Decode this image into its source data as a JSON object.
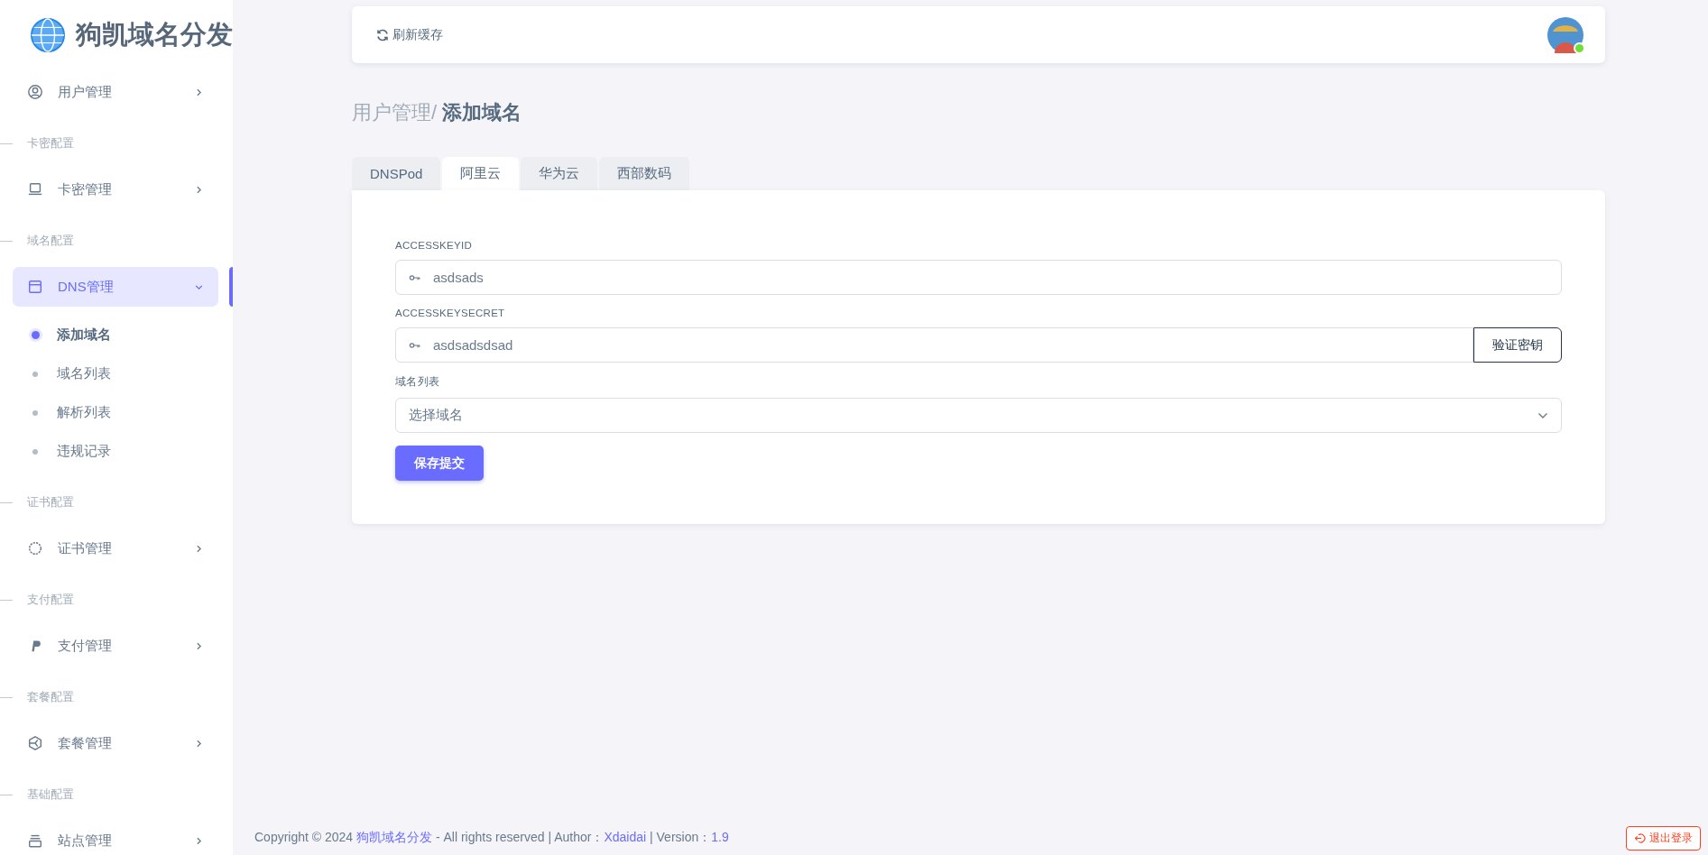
{
  "sidebar": {
    "brand": "狗凯域名分发",
    "sections": [
      {
        "items": [
          {
            "label": "用户管理",
            "selected": false,
            "expanded": false
          }
        ]
      },
      {
        "heading": "卡密配置",
        "items": [
          {
            "label": "卡密管理",
            "selected": false,
            "expanded": false
          }
        ]
      },
      {
        "heading": "域名配置",
        "items": [
          {
            "label": "DNS管理",
            "selected": true,
            "expanded": true,
            "children": [
              {
                "label": "添加域名",
                "selected": true
              },
              {
                "label": "域名列表",
                "selected": false
              },
              {
                "label": "解析列表",
                "selected": false
              },
              {
                "label": "违规记录",
                "selected": false
              }
            ]
          }
        ]
      },
      {
        "heading": "证书配置",
        "items": [
          {
            "label": "证书管理",
            "selected": false,
            "expanded": false
          }
        ]
      },
      {
        "heading": "支付配置",
        "items": [
          {
            "label": "支付管理",
            "selected": false,
            "expanded": false
          }
        ]
      },
      {
        "heading": "套餐配置",
        "items": [
          {
            "label": "套餐管理",
            "selected": false,
            "expanded": false
          }
        ]
      },
      {
        "heading": "基础配置",
        "items": [
          {
            "label": "站点管理",
            "selected": false,
            "expanded": false
          }
        ]
      }
    ]
  },
  "header": {
    "refresh_label": "刷新缓存",
    "avatar": {
      "online": true
    }
  },
  "breadcrumb": {
    "parent": "用户管理/",
    "current": "添加域名"
  },
  "tabs": [
    {
      "label": "DNSPod",
      "selected": false
    },
    {
      "label": "阿里云",
      "selected": true
    },
    {
      "label": "华为云",
      "selected": false
    },
    {
      "label": "西部数码",
      "selected": false
    }
  ],
  "form": {
    "fields": [
      {
        "label": "ACCESSKEYID",
        "value": "asdsads"
      },
      {
        "label": "ACCESSKEYSECRET",
        "value": "asdsadsdsad",
        "button": "验证密钥"
      }
    ],
    "select": {
      "label": "域名列表",
      "placeholder": "选择域名"
    },
    "submit": "保存提交"
  },
  "footer": {
    "parts": [
      {
        "kind": "text",
        "text": "Copyright © 2024 "
      },
      {
        "kind": "link",
        "text": "狗凯域名分发"
      },
      {
        "kind": "text",
        "text": " - All rights reserved | Author："
      },
      {
        "kind": "link",
        "text": "Xdaidai"
      },
      {
        "kind": "text",
        "text": " | Version："
      },
      {
        "kind": "link",
        "text": "1.9"
      }
    ],
    "logout": "退出登录"
  }
}
